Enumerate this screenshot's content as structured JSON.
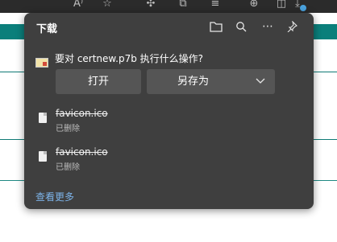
{
  "browser_toolbar": {
    "icons": [
      "read-aloud-icon",
      "favorite-icon",
      "extensions-icon",
      "favorites-list-icon",
      "collections-icon",
      "splitscreen-icon",
      "downloads-icon"
    ],
    "read_aloud_label": "A⁾",
    "downloads_badge_color": "#4aa3df"
  },
  "downloads": {
    "title": "下载",
    "header_icons": [
      "folder-icon",
      "search-icon",
      "more-icon",
      "pin-icon"
    ],
    "prompt": "要对 certnew.p7b 执行什么操作?",
    "open_button": "打开",
    "save_as_button": "另存为",
    "items": [
      {
        "name": "favicon.ico",
        "status": "已删除"
      },
      {
        "name": "favicon.ico",
        "status": "已删除"
      }
    ],
    "see_more": "查看更多"
  },
  "colors": {
    "panel_bg": "#3f3f3f",
    "button_bg": "#555555",
    "link": "#7db4ea",
    "page_accent": "#0b7f7b"
  }
}
